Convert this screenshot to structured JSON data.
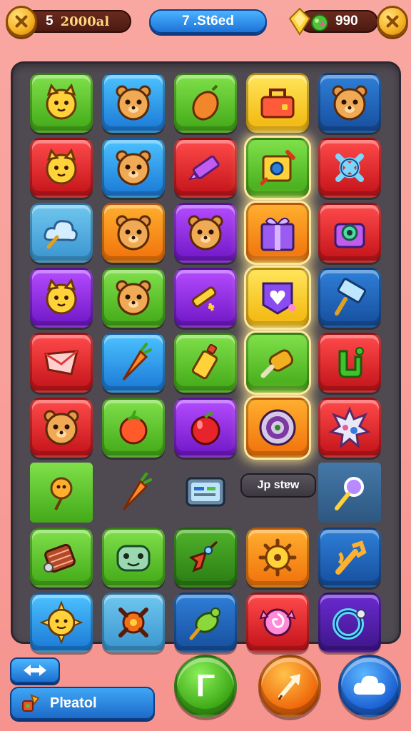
{
  "header": {
    "left_count": "5",
    "left_label": "2000al",
    "level_label": "7 .St6ed",
    "coins": "990"
  },
  "board": {
    "rows": [
      [
        {
          "color": "green",
          "icon": "cat-face-icon"
        },
        {
          "color": "blue",
          "icon": "bear-face-icon"
        },
        {
          "color": "green",
          "icon": "acorn-icon"
        },
        {
          "color": "yellow",
          "icon": "toolbox-icon"
        },
        {
          "color": "navy",
          "icon": "bear-face-icon"
        }
      ],
      [
        {
          "color": "red",
          "icon": "cat-face-icon"
        },
        {
          "color": "blue",
          "icon": "bear-face-icon"
        },
        {
          "color": "red",
          "icon": "crayon-icon"
        },
        {
          "color": "green",
          "icon": "gear-box-icon",
          "glow": true
        },
        {
          "color": "red",
          "icon": "bone-x-icon"
        }
      ],
      [
        {
          "color": "lightblue",
          "icon": "cloud-key-icon"
        },
        {
          "color": "orange",
          "icon": "bear-face-icon"
        },
        {
          "color": "purple",
          "icon": "bear-face-icon"
        },
        {
          "color": "orange",
          "icon": "gift-box-icon",
          "glow": true
        },
        {
          "color": "red",
          "icon": "camera-icon"
        }
      ],
      [
        {
          "color": "purple",
          "icon": "cat-face-icon"
        },
        {
          "color": "green",
          "icon": "bear-face-icon"
        },
        {
          "color": "purple",
          "icon": "key-icon"
        },
        {
          "color": "yellow",
          "icon": "heart-shield-icon",
          "glow": true
        },
        {
          "color": "navy",
          "icon": "hammer-icon"
        }
      ],
      [
        {
          "color": "red",
          "icon": "envelope-icon"
        },
        {
          "color": "blue",
          "icon": "carrot-icon"
        },
        {
          "color": "green",
          "icon": "bottle-icon"
        },
        {
          "color": "green",
          "icon": "bolt-tool-icon",
          "glow": true
        },
        {
          "color": "red",
          "icon": "clover-icon"
        }
      ],
      [
        {
          "color": "red",
          "icon": "bear-face-icon"
        },
        {
          "color": "green",
          "icon": "tomato-icon"
        },
        {
          "color": "purple",
          "icon": "apple-icon"
        },
        {
          "color": "orange",
          "icon": "target-icon",
          "glow": true
        },
        {
          "color": "red",
          "icon": "splat-icon"
        }
      ],
      [
        {
          "color": "green",
          "icon": "lollipop-icon",
          "flat": true
        },
        {
          "color": "none",
          "icon": "carrot-icon"
        },
        {
          "color": "none",
          "icon": "screen-icon"
        },
        {
          "color": "none",
          "icon": "",
          "chip": true
        },
        {
          "color": "slate",
          "icon": "magnifier-icon",
          "flat": true
        }
      ],
      [
        {
          "color": "green",
          "icon": "drum-icon"
        },
        {
          "color": "green",
          "icon": "frog-face-icon"
        },
        {
          "color": "darkgreen",
          "icon": "rocket-icon"
        },
        {
          "color": "orange",
          "icon": "sun-gear-icon"
        },
        {
          "color": "navy",
          "icon": "wrench-icon"
        }
      ],
      [
        {
          "color": "blue",
          "icon": "sun-face-icon"
        },
        {
          "color": "lightblue",
          "icon": "spiky-gear-icon"
        },
        {
          "color": "navy",
          "icon": "turtle-icon"
        },
        {
          "color": "red",
          "icon": "candy-icon"
        },
        {
          "color": "darkpurple",
          "icon": "ring-icon"
        }
      ]
    ],
    "chip_label": "Jp stɐw"
  },
  "footer": {
    "bottom_label": "Plɐatol",
    "green_button_glyph": "Γ"
  },
  "colors": {
    "background": "#f8a09a",
    "board": "#4f4a52",
    "accent_gold": "#f5b021",
    "accent_blue": "#1d73d8"
  }
}
